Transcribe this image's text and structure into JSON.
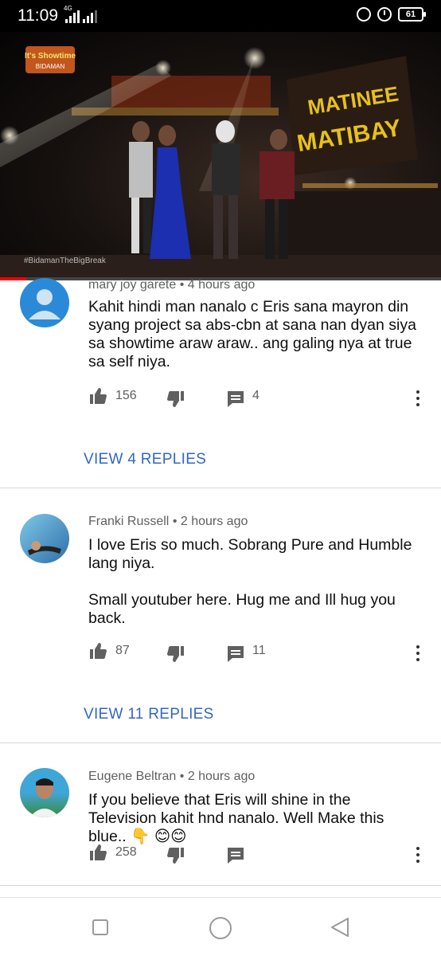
{
  "status_bar": {
    "time": "11:09",
    "network": "4G",
    "battery": "61",
    "icons": [
      "signal-icon",
      "lock-rotation-icon",
      "alarm-icon",
      "battery-icon"
    ]
  },
  "video": {
    "channel_logo": "It's Showtime",
    "stage_sign": "MATINEE MATIBAY",
    "hashtag": "#BidamanTheBigBreak",
    "progress_fraction": 0.06
  },
  "comments": [
    {
      "author": "mary joy garete",
      "time": "4 hours ago",
      "text": "Kahit hindi man nanalo c Eris sana mayron din syang project sa abs-cbn at sana nan dyan siya sa showtime araw araw.. ang galing nya at true sa self niya.",
      "likes": "156",
      "reply_count": "4",
      "view_replies": "VIEW 4 REPLIES"
    },
    {
      "author": "Franki Russell",
      "time": "2 hours ago",
      "text": "I love Eris so much. Sobrang Pure and Humble lang niya.\n\nSmall youtuber here. Hug me and Ill hug you back.",
      "likes": "87",
      "reply_count": "11",
      "view_replies": "VIEW 11 REPLIES"
    },
    {
      "author": "Eugene Beltran",
      "time": "2 hours ago",
      "text": "If you believe that Eris will shine in the Television kahit hnd nanalo. Well Make this blue.. 👇 😊😊",
      "likes": "258",
      "reply_count": ""
    }
  ],
  "colors": {
    "accent": "#3267c8",
    "progress": "#e00000",
    "icon": "#606060"
  }
}
